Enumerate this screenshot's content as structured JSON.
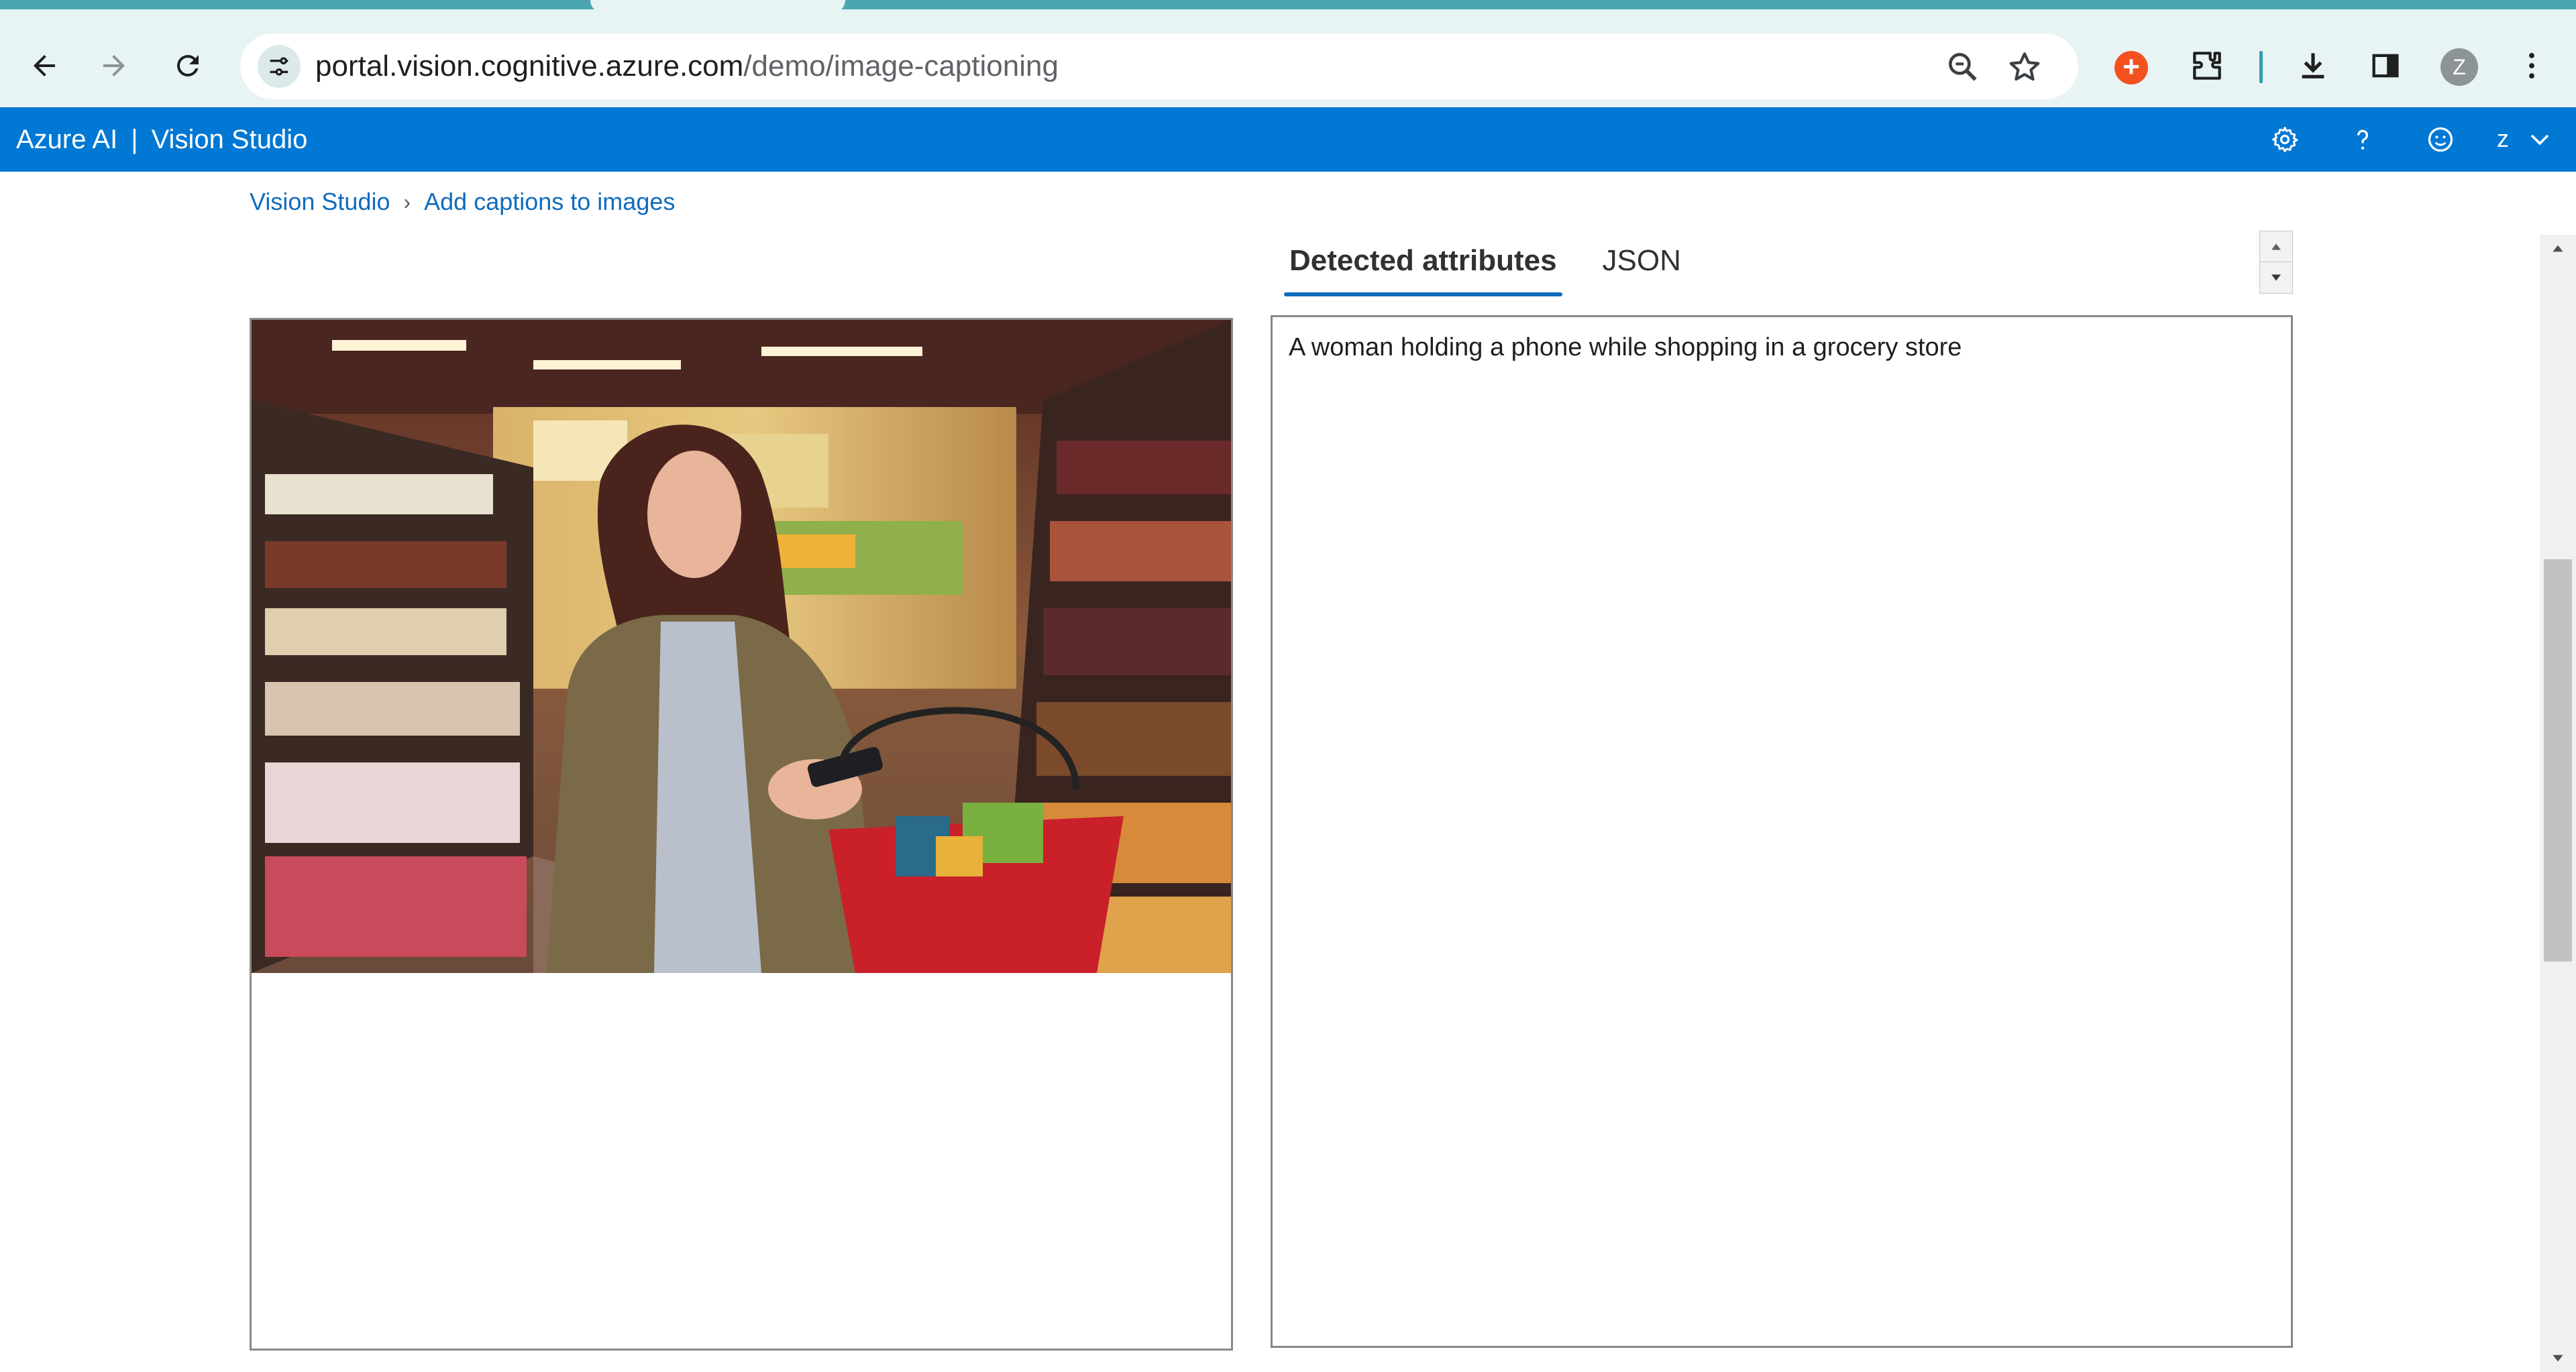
{
  "browser": {
    "url_host": "portal.vision.cognitive.azure.com",
    "url_path": "/demo/image-captioning",
    "profile_initial": "Z",
    "icons": [
      "back-icon",
      "forward-icon",
      "reload-icon",
      "site-info-icon",
      "zoom-icon",
      "bookmark-star-icon",
      "extension-icon",
      "puzzle-icon",
      "download-icon",
      "side-panel-icon",
      "menu-icon"
    ]
  },
  "app": {
    "brand": "Azure AI",
    "separator": "|",
    "product": "Vision Studio",
    "user_initial": "z",
    "icons": [
      "gear-icon",
      "help-icon",
      "feedback-icon",
      "chevron-down-icon"
    ],
    "accent_color": "#0078d4"
  },
  "breadcrumb": {
    "root": "Vision Studio",
    "current": "Add captions to images"
  },
  "result_tabs": [
    {
      "label": "Detected attributes",
      "active": true
    },
    {
      "label": "JSON",
      "active": false
    }
  ],
  "result": {
    "caption": "A woman holding a phone while shopping in a grocery store"
  }
}
